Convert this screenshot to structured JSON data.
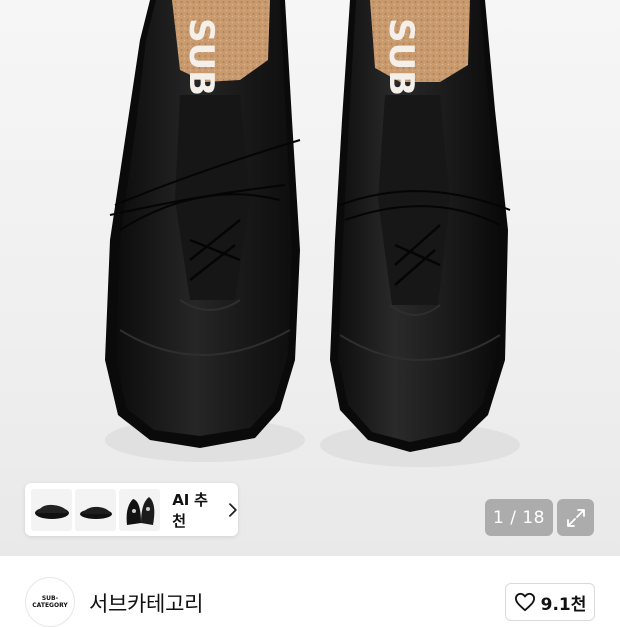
{
  "gallery": {
    "image_subject": "black-leather-lace-up-shoes",
    "insole_text": "SUB",
    "counter": "1 / 18",
    "ai_recommend_label": "AI 추천"
  },
  "brand": {
    "logo_line1": "SUB-",
    "logo_line2": "CATEGORY",
    "name": "서브카테고리"
  },
  "like": {
    "count": "9.1천"
  },
  "colors": {
    "gallery_bg": "#efefef",
    "overlay": "rgba(120,120,120,0.55)",
    "text": "#111111"
  }
}
